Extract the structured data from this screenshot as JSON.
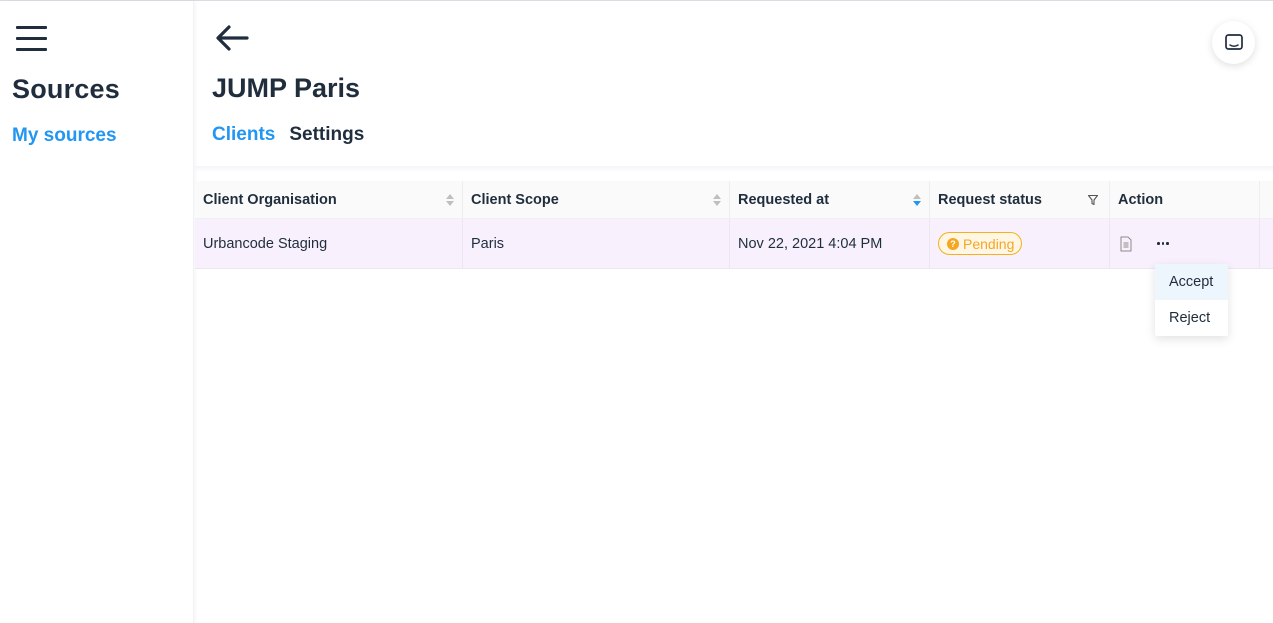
{
  "sidebar": {
    "menu_icon": "hamburger-menu-icon",
    "title": "Sources",
    "link": "My sources"
  },
  "header": {
    "back_icon": "arrow-left-icon",
    "title": "JUMP Paris",
    "tabs": [
      {
        "label": "Clients",
        "active": true
      },
      {
        "label": "Settings",
        "active": false
      }
    ],
    "chat_icon": "chat-message-icon"
  },
  "table": {
    "columns": [
      {
        "label": "Client Organisation",
        "sortable": true
      },
      {
        "label": "Client Scope",
        "sortable": true
      },
      {
        "label": "Requested at",
        "sortable": true,
        "sort": "descending"
      },
      {
        "label": "Request status",
        "filterable": true
      },
      {
        "label": "Action"
      }
    ],
    "rows": [
      {
        "organisation": "Urbancode Staging",
        "scope": "Paris",
        "requested_at": "Nov 22, 2021 4:04 PM",
        "status": "Pending",
        "status_color": "#f5a623",
        "actions": [
          "document-icon",
          "more-options-icon"
        ]
      }
    ]
  },
  "action_menu": {
    "items": [
      {
        "label": "Accept",
        "hovered": true
      },
      {
        "label": "Reject",
        "hovered": false
      }
    ]
  },
  "colors": {
    "accent": "#2196f3",
    "text": "#1f2d3d",
    "row_highlight": "#f8f1fd",
    "pending": "#f5a623"
  }
}
